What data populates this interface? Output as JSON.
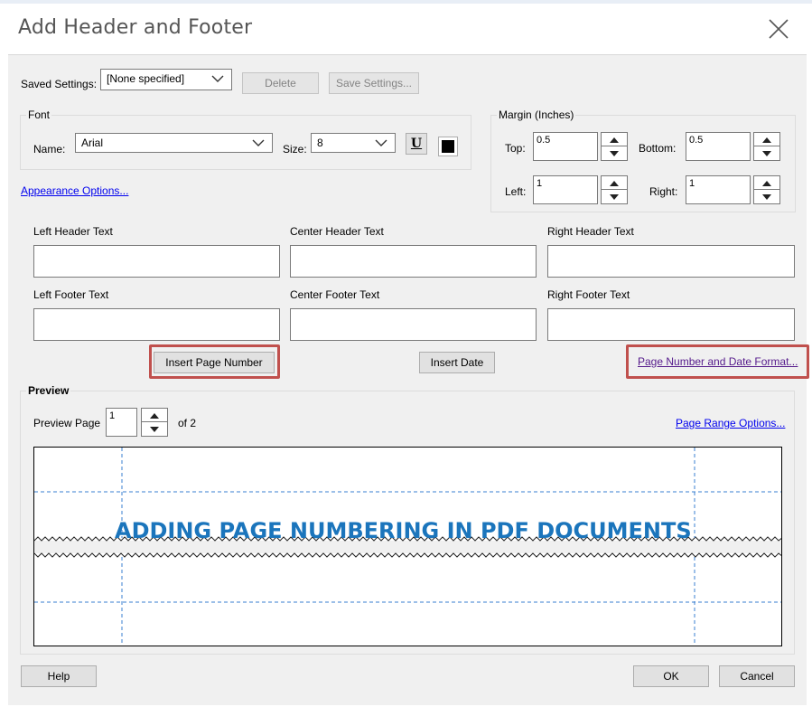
{
  "dialog": {
    "title": "Add Header and Footer"
  },
  "saved_settings": {
    "label": "Saved Settings:",
    "value": "[None specified]",
    "delete_label": "Delete",
    "save_label": "Save Settings..."
  },
  "font": {
    "group_title": "Font",
    "name_label": "Name:",
    "name_value": "Arial",
    "size_label": "Size:",
    "size_value": "8",
    "underline_glyph": "U",
    "color": "#000000"
  },
  "appearance_link": "Appearance Options...",
  "margin": {
    "group_title": "Margin (Inches)",
    "top_label": "Top:",
    "top_value": "0.5",
    "bottom_label": "Bottom:",
    "bottom_value": "0.5",
    "left_label": "Left:",
    "left_value": "1",
    "right_label": "Right:",
    "right_value": "1"
  },
  "text_fields": {
    "left_header": "Left Header Text",
    "center_header": "Center Header Text",
    "right_header": "Right Header Text",
    "left_footer": "Left Footer Text",
    "center_footer": "Center Footer Text",
    "right_footer": "Right Footer Text"
  },
  "actions": {
    "insert_page_number": "Insert Page Number",
    "insert_date": "Insert Date",
    "format_link": "Page Number and Date Format..."
  },
  "preview": {
    "group_title": "Preview",
    "page_label": "Preview Page",
    "page_value": "1",
    "of_label": "of 2",
    "range_link": "Page Range Options...",
    "banner_text": "ADDING PAGE NUMBERING IN PDF DOCUMENTS"
  },
  "footer_buttons": {
    "help": "Help",
    "ok": "OK",
    "cancel": "Cancel"
  },
  "colors": {
    "highlight": "#c0504d",
    "banner": "#1b75bc",
    "guide": "#3a7fd0"
  },
  "icons": {
    "close": "close-icon",
    "dropdown": "chevron-down-icon",
    "spin_up": "triangle-up-icon",
    "spin_down": "triangle-down-icon",
    "underline": "underline-icon"
  }
}
